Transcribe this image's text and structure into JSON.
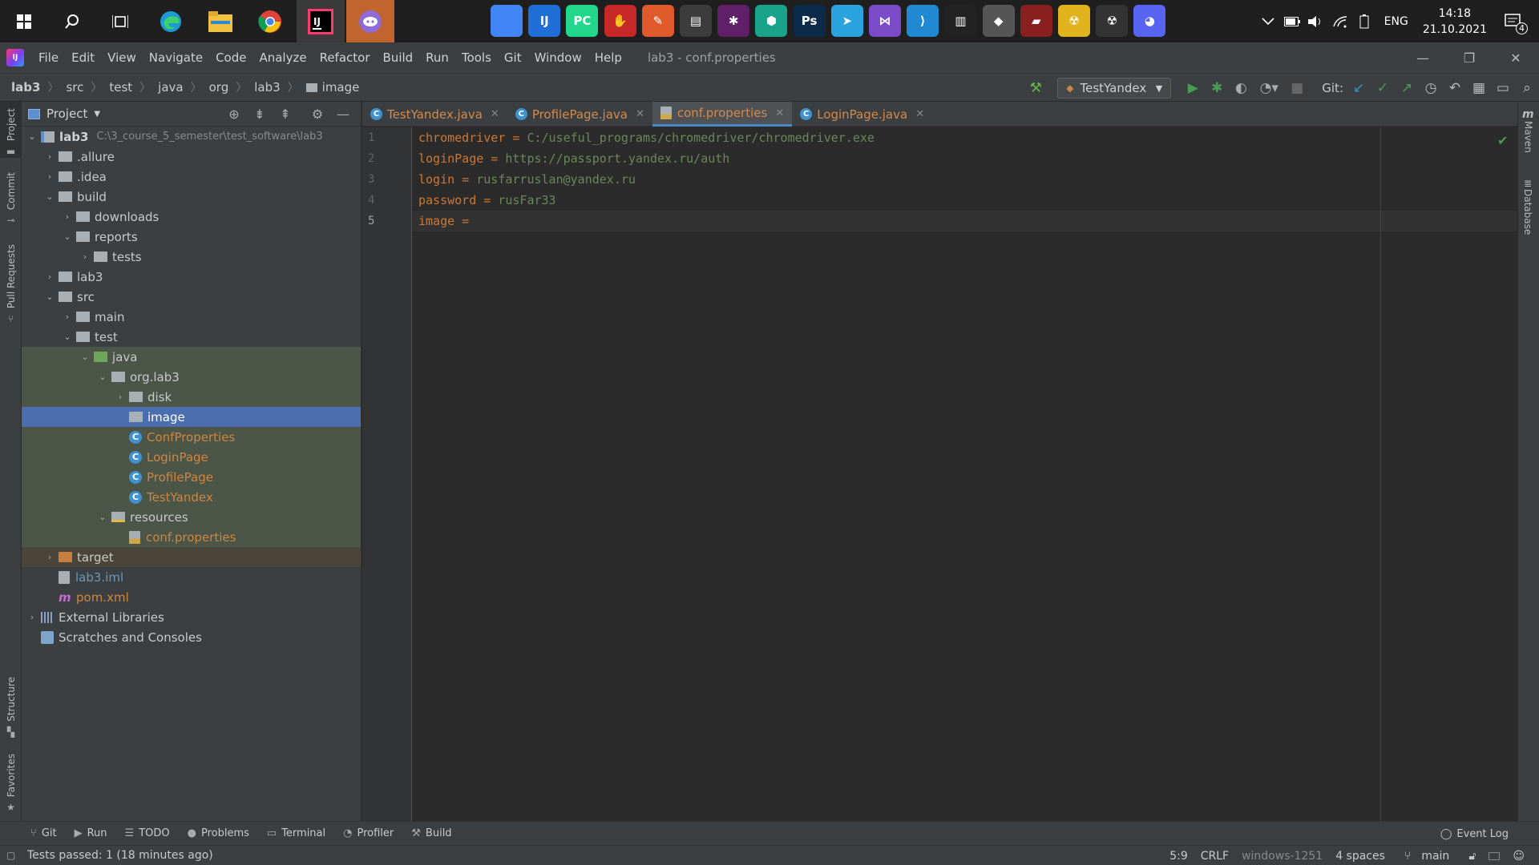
{
  "taskbar": {
    "apps": [
      {
        "name": "start-icon",
        "glyph": "⊞"
      },
      {
        "name": "search-icon",
        "glyph": "⌕"
      },
      {
        "name": "task-view-icon",
        "glyph": "❐"
      },
      {
        "name": "edge-icon",
        "glyph": ""
      },
      {
        "name": "file-explorer-icon",
        "glyph": ""
      },
      {
        "name": "chrome-icon",
        "glyph": ""
      },
      {
        "name": "intellij-icon",
        "glyph": "IJ"
      },
      {
        "name": "discord-canary-icon",
        "glyph": ""
      }
    ],
    "pinned": [
      {
        "name": "chrome-pinned-icon",
        "label": "",
        "color": "#4285f4"
      },
      {
        "name": "intellij-pinned-icon",
        "label": "IJ",
        "color": "#1f6fd6"
      },
      {
        "name": "pycharm-icon",
        "label": "PC",
        "color": "#21d789"
      },
      {
        "name": "bloody-icon",
        "label": "✋",
        "color": "#c62828"
      },
      {
        "name": "brush-app-icon",
        "label": "✎",
        "color": "#e05a2b"
      },
      {
        "name": "terminal-app-icon",
        "label": "▤",
        "color": "#3c3c3c"
      },
      {
        "name": "slack-icon",
        "label": "✱",
        "color": "#611f69"
      },
      {
        "name": "shield-app-icon",
        "label": "⬢",
        "color": "#1aa38b"
      },
      {
        "name": "photoshop-icon",
        "label": "Ps",
        "color": "#0c2a4a"
      },
      {
        "name": "telegram-icon",
        "label": "➤",
        "color": "#2aa3df"
      },
      {
        "name": "visual-studio-icon",
        "label": "⋈",
        "color": "#7b4bc9"
      },
      {
        "name": "vscode-icon",
        "label": "⟩",
        "color": "#1f8ad2"
      },
      {
        "name": "stats-app-icon",
        "label": "▥",
        "color": "#222"
      },
      {
        "name": "inkscape-icon",
        "label": "◆",
        "color": "#555"
      },
      {
        "name": "game-icon",
        "label": "▰",
        "color": "#8a1f1f"
      },
      {
        "name": "radiation-icon",
        "label": "☢",
        "color": "#e0b21c"
      },
      {
        "name": "radiation-dark-icon",
        "label": "☢",
        "color": "#333"
      },
      {
        "name": "discord-icon",
        "label": "◕",
        "color": "#5865f2"
      }
    ],
    "lang": "ENG",
    "time": "14:18",
    "date": "21.10.2021",
    "notifications": "4"
  },
  "menu": {
    "items": [
      "File",
      "Edit",
      "View",
      "Navigate",
      "Code",
      "Analyze",
      "Refactor",
      "Build",
      "Run",
      "Tools",
      "Git",
      "Window",
      "Help"
    ],
    "window_title": "lab3 - conf.properties"
  },
  "nav": {
    "breadcrumbs": [
      "lab3",
      "src",
      "test",
      "java",
      "org",
      "lab3",
      "image"
    ],
    "run_config": "TestYandex",
    "git_label": "Git:"
  },
  "left_strip": {
    "project": "Project",
    "commit": "Commit",
    "pull_requests": "Pull Requests",
    "structure": "Structure",
    "favorites": "Favorites"
  },
  "right_strip": {
    "maven": "Maven",
    "database": "Database"
  },
  "project": {
    "header": "Project",
    "root_name": "lab3",
    "root_path": "C:\\3_course_5_semester\\test_software\\lab3",
    "nodes": {
      "allure": ".allure",
      "idea": ".idea",
      "build": "build",
      "downloads": "downloads",
      "reports": "reports",
      "tests": "tests",
      "lab3": "lab3",
      "src": "src",
      "main": "main",
      "test": "test",
      "java": "java",
      "org_lab3": "org.lab3",
      "disk": "disk",
      "image": "image",
      "conf_properties_class": "ConfProperties",
      "login_page": "LoginPage",
      "profile_page": "ProfilePage",
      "test_yandex": "TestYandex",
      "resources": "resources",
      "conf_properties_file": "conf.properties",
      "target": "target",
      "lab3_iml": "lab3.iml",
      "pom_xml": "pom.xml",
      "external_libraries": "External Libraries",
      "scratches": "Scratches and Consoles"
    }
  },
  "editor": {
    "tabs": [
      "TestYandex.java",
      "ProfilePage.java",
      "conf.properties",
      "LoginPage.java"
    ],
    "active_tab": 2,
    "lines": [
      {
        "num": "1",
        "key": "chromedriver",
        "value": "C:/useful_programs/chromedriver/chromedriver.exe"
      },
      {
        "num": "2",
        "key": "loginPage",
        "value": "https://passport.yandex.ru/auth"
      },
      {
        "num": "3",
        "key": "login",
        "value": "rusfarruslan@yandex.ru"
      },
      {
        "num": "4",
        "key": "password",
        "value": "rusFar33"
      },
      {
        "num": "5",
        "key": "image",
        "value": ""
      }
    ]
  },
  "bottom_tabs": [
    "Git",
    "Run",
    "TODO",
    "Problems",
    "Terminal",
    "Profiler",
    "Build"
  ],
  "event_log": "Event Log",
  "status": {
    "message": "Tests passed: 1 (18 minutes ago)",
    "position": "5:9",
    "line_sep": "CRLF",
    "encoding": "windows-1251",
    "indent": "4 spaces",
    "branch": "main"
  }
}
